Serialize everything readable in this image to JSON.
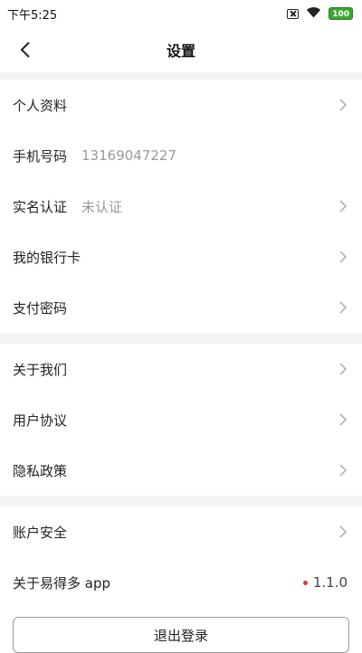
{
  "status_bar": {
    "time": "下午5:25",
    "battery": "100"
  },
  "nav": {
    "title": "设置"
  },
  "groups": [
    {
      "items": [
        {
          "label": "个人资料",
          "value": "",
          "chevron": true
        },
        {
          "label": "手机号码",
          "value": "13169047227",
          "chevron": false
        },
        {
          "label": "实名认证",
          "value": "未认证",
          "chevron": true
        },
        {
          "label": "我的银行卡",
          "value": "",
          "chevron": true
        },
        {
          "label": "支付密码",
          "value": "",
          "chevron": true
        }
      ]
    },
    {
      "items": [
        {
          "label": "关于我们",
          "value": "",
          "chevron": true
        },
        {
          "label": "用户协议",
          "value": "",
          "chevron": true
        },
        {
          "label": "隐私政策",
          "value": "",
          "chevron": true
        }
      ]
    },
    {
      "items": [
        {
          "label": "账户安全",
          "value": "",
          "chevron": true
        },
        {
          "label": "关于易得多 app",
          "value": "",
          "version": "1.1.0",
          "chevron": false
        }
      ]
    }
  ],
  "logout": {
    "label": "退出登录"
  },
  "colors": {
    "divider_bg": "#f3f3f3",
    "secondary_text": "#9a9a9a",
    "battery_green": "#3fa535",
    "dot_red": "#e0352f"
  }
}
